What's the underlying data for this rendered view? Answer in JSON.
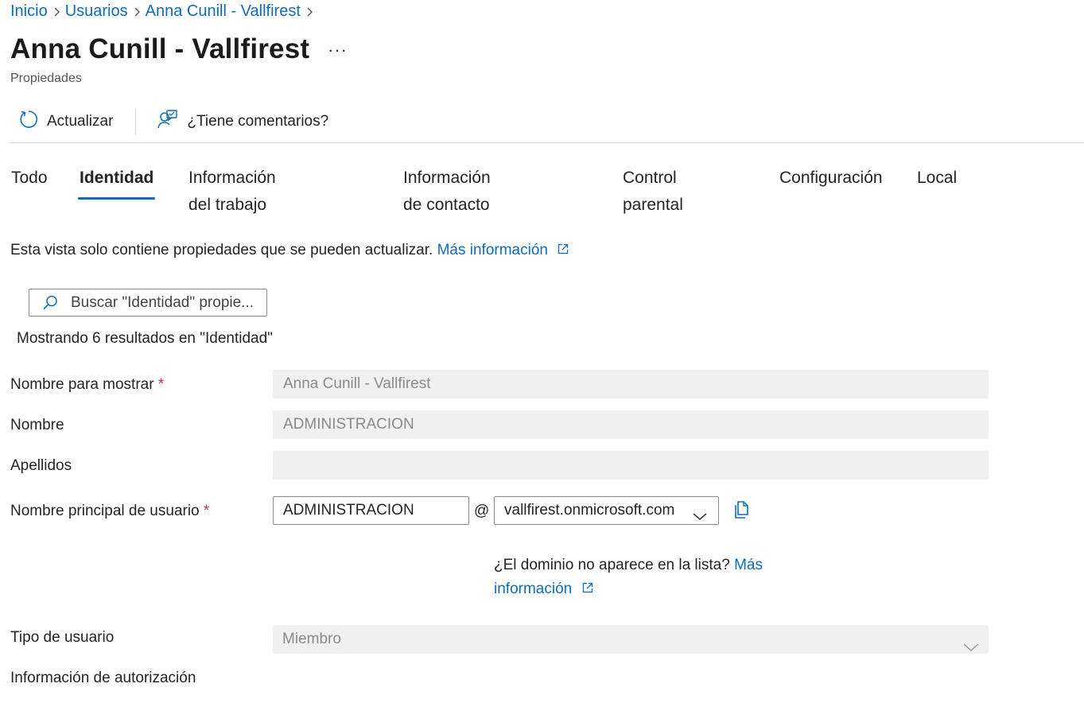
{
  "breadcrumb": {
    "items": [
      "Inicio",
      "Usuarios",
      "Anna Cunill - Vallfirest"
    ]
  },
  "header": {
    "title": "Anna Cunill - Vallfirest",
    "more_label": "···",
    "subtitle": "Propiedades"
  },
  "toolbar": {
    "refresh_label": "Actualizar",
    "feedback_label": "¿Tiene comentarios?"
  },
  "tabs": [
    {
      "label": "Todo"
    },
    {
      "label": "Identidad",
      "active": true
    },
    {
      "label": "Información del trabajo"
    },
    {
      "label": "Información de contacto"
    },
    {
      "label": "Control parental"
    },
    {
      "label": "Configuración"
    },
    {
      "label": "Local"
    }
  ],
  "info": {
    "text": "Esta vista solo contiene propiedades que se pueden actualizar.",
    "link": "Más información"
  },
  "search": {
    "placeholder": "Buscar \"Identidad\" propie..."
  },
  "results_text": "Mostrando 6 resultados en \"Identidad\"",
  "form": {
    "display_name": {
      "label": "Nombre para mostrar",
      "required": "*",
      "value": "Anna Cunill - Vallfirest"
    },
    "first_name": {
      "label": "Nombre",
      "value": "ADMINISTRACION"
    },
    "last_name": {
      "label": "Apellidos",
      "value": ""
    },
    "upn": {
      "label": "Nombre principal de usuario",
      "required": "*",
      "value": "ADMINISTRACION",
      "at": "@",
      "domain": "vallfirest.onmicrosoft.com"
    },
    "domain_help": {
      "text": "¿El dominio no aparece en la lista?",
      "link": "Más información"
    },
    "user_type": {
      "label": "Tipo de usuario",
      "value": "Miembro"
    },
    "auth_info": {
      "label": "Información de autorización"
    }
  },
  "colors": {
    "accent": "#0f6cbd",
    "required": "#c4314b",
    "disabled_field": "#f0f0f0"
  }
}
